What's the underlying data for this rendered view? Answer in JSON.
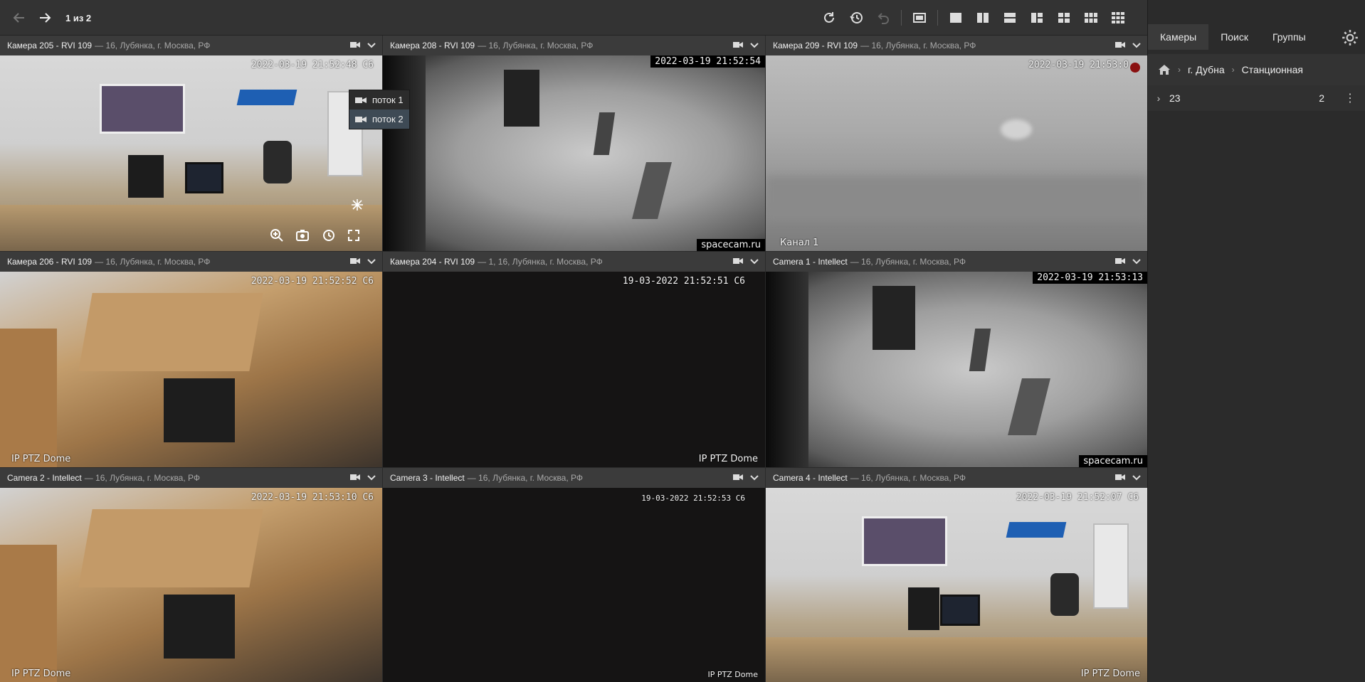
{
  "toolbar": {
    "pager": "1 из 2",
    "icons": [
      "back-arrow-icon",
      "forward-arrow-icon",
      "refresh-icon",
      "history-icon",
      "undo-icon",
      "fullscreen-layout-icon",
      "layout-1-icon",
      "layout-2-icon",
      "layout-2h-icon",
      "layout-3-icon",
      "layout-4-icon",
      "layout-6-icon",
      "layout-9-icon"
    ]
  },
  "panel": {
    "tabs": [
      {
        "label": "Камеры"
      },
      {
        "label": "Поиск"
      },
      {
        "label": "Группы"
      }
    ],
    "breadcrumb": {
      "items": [
        "г. Дубна",
        "Станционная"
      ]
    },
    "tree": [
      {
        "label": "23",
        "count": "2"
      }
    ]
  },
  "dropdown": {
    "items": [
      {
        "label": "поток 1"
      },
      {
        "label": "поток 2"
      }
    ]
  },
  "cameras": [
    {
      "name": "Камера 205 - RVI 109",
      "location": "— 16, Лубянка, г. Москва, РФ",
      "timestamp": "2022-03-19 21:52:48 C6",
      "watermark": ""
    },
    {
      "name": "Камера 208 - RVI 109",
      "location": "— 16, Лубянка, г. Москва, РФ",
      "timestamp": "2022-03-19 21:52:54",
      "watermark": "spacecam.ru"
    },
    {
      "name": "Камера 209 - RVI 109",
      "location": "— 16, Лубянка, г. Москва, РФ",
      "timestamp": "2022-03-19 21:53:0",
      "watermark": "Канал 1"
    },
    {
      "name": "Камера 206 - RVI 109",
      "location": "— 16, Лубянка, г. Москва, РФ",
      "timestamp": "2022-03-19 21:52:52 C6",
      "watermark": "IP PTZ Dome"
    },
    {
      "name": "Камера 204 - RVI 109",
      "location": "— 1, 16, Лубянка, г. Москва, РФ",
      "timestamp": "19-03-2022 21:52:51 C6",
      "watermark": "IP PTZ Dome"
    },
    {
      "name": "Camera 1 - Intellect",
      "location": "— 16, Лубянка, г. Москва, РФ",
      "timestamp": "2022-03-19 21:53:13",
      "watermark": "spacecam.ru"
    },
    {
      "name": "Camera 2 - Intellect",
      "location": "— 16, Лубянка, г. Москва, РФ",
      "timestamp": "2022-03-19 21:53:10 C6",
      "watermark": "IP PTZ Dome"
    },
    {
      "name": "Camera 3 - Intellect",
      "location": "— 16, Лубянка, г. Москва, РФ",
      "timestamp": "19-03-2022 21:52:53 C6",
      "watermark": "IP PTZ Dome"
    },
    {
      "name": "Camera 4 - Intellect",
      "location": "— 16, Лубянка, г. Москва, РФ",
      "timestamp": "2022-03-19 21:52:07 C6",
      "watermark": "IP PTZ Dome"
    }
  ]
}
